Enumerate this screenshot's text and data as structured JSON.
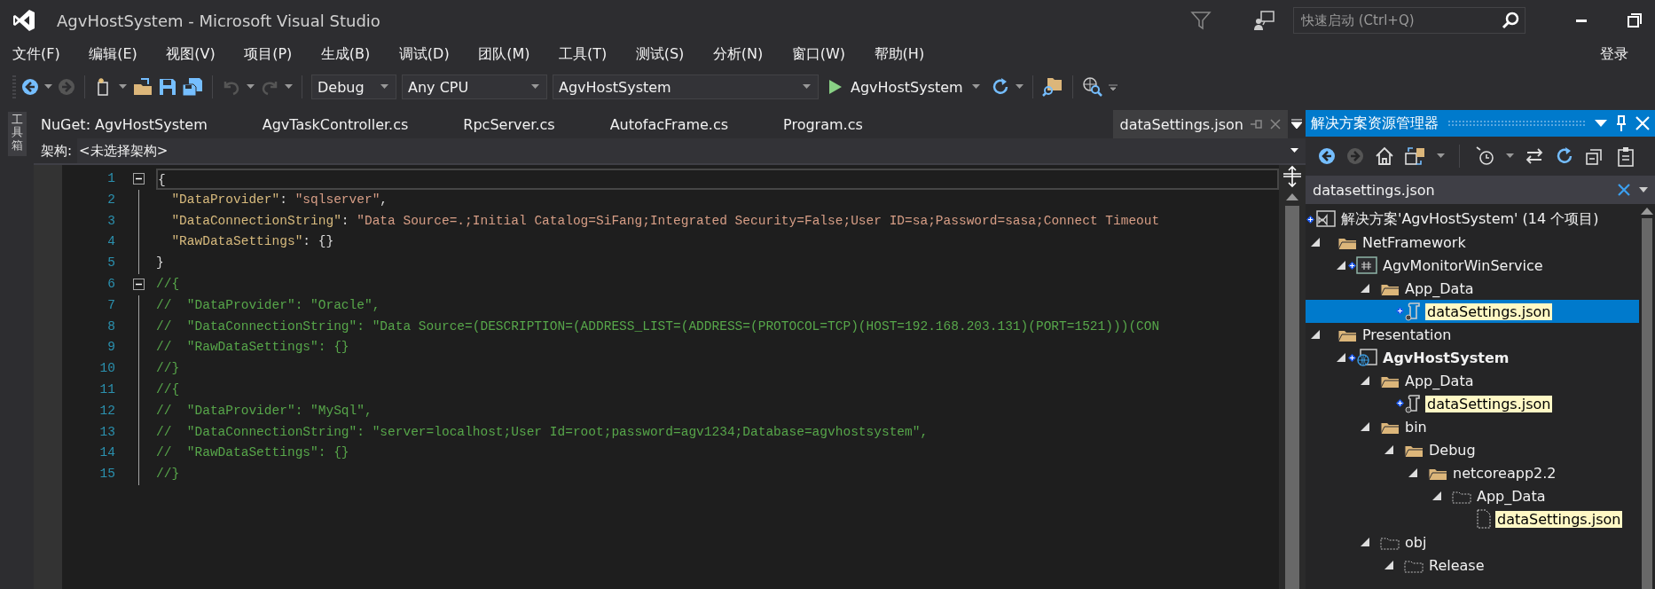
{
  "window": {
    "title": "AgvHostSystem - Microsoft Visual Studio"
  },
  "quick_launch": {
    "placeholder": "快速启动 (Ctrl+Q)"
  },
  "menu": [
    "文件(F)",
    "编辑(E)",
    "视图(V)",
    "项目(P)",
    "生成(B)",
    "调试(D)",
    "团队(M)",
    "工具(T)",
    "测试(S)",
    "分析(N)",
    "窗口(W)",
    "帮助(H)"
  ],
  "sign_in": "登录",
  "toolbar": {
    "configuration": "Debug",
    "platform": "Any CPU",
    "startup_project": "AgvHostSystem",
    "run": "AgvHostSystem"
  },
  "toolbox_tab": "工具箱",
  "tabs": [
    {
      "label": "NuGet: AgvHostSystem",
      "selected": false
    },
    {
      "label": "AgvTaskController.cs",
      "selected": false
    },
    {
      "label": "RpcServer.cs",
      "selected": false
    },
    {
      "label": "AutofacFrame.cs",
      "selected": false
    },
    {
      "label": "Program.cs",
      "selected": false
    },
    {
      "label": "dataSettings.json",
      "selected": true
    }
  ],
  "nav_bar": {
    "label": "架构:",
    "value": "<未选择架构>"
  },
  "code_lines": [
    {
      "number": "1",
      "fold_toggle": true,
      "current": true,
      "tokens": [
        {
          "kind": "punct",
          "text": "{"
        }
      ]
    },
    {
      "number": "2",
      "fold_toggle": false,
      "current": false,
      "tokens": [
        {
          "kind": "key",
          "text": "  \"DataProvider\""
        },
        {
          "kind": "punct",
          "text": ": "
        },
        {
          "kind": "string",
          "text": "\"sqlserver\""
        },
        {
          "kind": "punct",
          "text": ","
        }
      ]
    },
    {
      "number": "3",
      "fold_toggle": false,
      "current": false,
      "tokens": [
        {
          "kind": "key",
          "text": "  \"DataConnectionString\""
        },
        {
          "kind": "punct",
          "text": ": "
        },
        {
          "kind": "string",
          "text": "\"Data Source=.;Initial Catalog=SiFang;Integrated Security=False;User ID=sa;Password=sasa;Connect Timeout"
        }
      ]
    },
    {
      "number": "4",
      "fold_toggle": false,
      "current": false,
      "tokens": [
        {
          "kind": "key",
          "text": "  \"RawDataSettings\""
        },
        {
          "kind": "punct",
          "text": ": {}"
        }
      ]
    },
    {
      "number": "5",
      "fold_toggle": false,
      "current": false,
      "tokens": [
        {
          "kind": "punct",
          "text": "}"
        }
      ]
    },
    {
      "number": "6",
      "fold_toggle": true,
      "current": false,
      "tokens": [
        {
          "kind": "comment",
          "text": "//{"
        }
      ]
    },
    {
      "number": "7",
      "fold_toggle": false,
      "current": false,
      "tokens": [
        {
          "kind": "comment",
          "text": "//  \"DataProvider\": \"Oracle\","
        }
      ]
    },
    {
      "number": "8",
      "fold_toggle": false,
      "current": false,
      "tokens": [
        {
          "kind": "comment",
          "text": "//  \"DataConnectionString\": \"Data Source=(DESCRIPTION=(ADDRESS_LIST=(ADDRESS=(PROTOCOL=TCP)(HOST=192.168.203.131)(PORT=1521)))(CON"
        }
      ]
    },
    {
      "number": "9",
      "fold_toggle": false,
      "current": false,
      "tokens": [
        {
          "kind": "comment",
          "text": "//  \"RawDataSettings\": {}"
        }
      ]
    },
    {
      "number": "10",
      "fold_toggle": false,
      "current": false,
      "tokens": [
        {
          "kind": "comment",
          "text": "//}"
        }
      ]
    },
    {
      "number": "11",
      "fold_toggle": false,
      "current": false,
      "tokens": [
        {
          "kind": "comment",
          "text": "//{"
        }
      ]
    },
    {
      "number": "12",
      "fold_toggle": false,
      "current": false,
      "tokens": [
        {
          "kind": "comment",
          "text": "//  \"DataProvider\": \"MySql\","
        }
      ]
    },
    {
      "number": "13",
      "fold_toggle": false,
      "current": false,
      "tokens": [
        {
          "kind": "comment",
          "text": "//  \"DataConnectionString\": \"server=localhost;User Id=root;password=agv1234;Database=agvhostsystem\","
        }
      ]
    },
    {
      "number": "14",
      "fold_toggle": false,
      "current": false,
      "tokens": [
        {
          "kind": "comment",
          "text": "//  \"RawDataSettings\": {}"
        }
      ]
    },
    {
      "number": "15",
      "fold_toggle": false,
      "current": false,
      "tokens": [
        {
          "kind": "comment",
          "text": "//}"
        }
      ]
    }
  ],
  "solution_explorer": {
    "title": "解决方案资源管理器",
    "search": {
      "value": "datasettings.json"
    },
    "tree": [
      {
        "kind": "solution",
        "label": "解决方案'AgvHostSystem' (14 个项目)",
        "added": true,
        "selected": false,
        "match": false,
        "bold": false
      },
      {
        "kind": "folder",
        "label": "NetFramework",
        "expanded": true,
        "added": false,
        "selected": false,
        "match": false,
        "bold": false,
        "children": [
          {
            "kind": "csproj",
            "label": "AgvMonitorWinService",
            "expanded": true,
            "added": true,
            "selected": false,
            "match": false,
            "bold": false,
            "children": [
              {
                "kind": "folder",
                "label": "App_Data",
                "expanded": true,
                "added": false,
                "selected": false,
                "match": false,
                "bold": false,
                "children": [
                  {
                    "kind": "json",
                    "label": "dataSettings.json",
                    "added": true,
                    "selected": true,
                    "match": true,
                    "bold": false
                  }
                ]
              }
            ]
          }
        ]
      },
      {
        "kind": "folder",
        "label": "Presentation",
        "expanded": true,
        "added": false,
        "selected": false,
        "match": false,
        "bold": false,
        "children": [
          {
            "kind": "webproj",
            "label": "AgvHostSystem",
            "expanded": true,
            "added": true,
            "selected": false,
            "match": false,
            "bold": true,
            "children": [
              {
                "kind": "folder",
                "label": "App_Data",
                "expanded": true,
                "added": false,
                "selected": false,
                "match": false,
                "bold": false,
                "children": [
                  {
                    "kind": "json",
                    "label": "dataSettings.json",
                    "added": true,
                    "selected": false,
                    "match": true,
                    "bold": false
                  }
                ]
              },
              {
                "kind": "folder",
                "label": "bin",
                "expanded": true,
                "added": false,
                "selected": false,
                "match": false,
                "bold": false,
                "children": [
                  {
                    "kind": "folder",
                    "label": "Debug",
                    "expanded": true,
                    "added": false,
                    "selected": false,
                    "match": false,
                    "bold": false,
                    "children": [
                      {
                        "kind": "folder",
                        "label": "netcoreapp2.2",
                        "expanded": true,
                        "added": false,
                        "selected": false,
                        "match": false,
                        "bold": false,
                        "children": [
                          {
                            "kind": "excluded-folder",
                            "label": "App_Data",
                            "expanded": true,
                            "added": false,
                            "selected": false,
                            "match": false,
                            "bold": false,
                            "children": [
                              {
                                "kind": "excluded-file",
                                "label": "dataSettings.json",
                                "added": false,
                                "selected": false,
                                "match": true,
                                "bold": false
                              }
                            ]
                          }
                        ]
                      }
                    ]
                  }
                ]
              },
              {
                "kind": "excluded-folder",
                "label": "obj",
                "expanded": true,
                "added": false,
                "selected": false,
                "match": false,
                "bold": false,
                "children": [
                  {
                    "kind": "excluded-folder",
                    "label": "Release",
                    "expanded": true,
                    "added": false,
                    "selected": false,
                    "match": false,
                    "bold": false
                  }
                ]
              }
            ]
          }
        ]
      }
    ]
  }
}
